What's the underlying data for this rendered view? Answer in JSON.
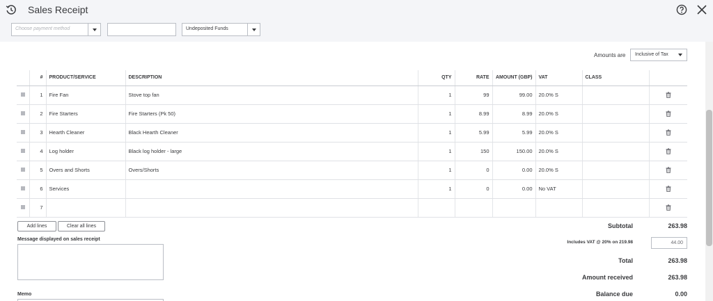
{
  "header": {
    "title": "Sales Receipt"
  },
  "payment": {
    "method_placeholder": "Choose payment method",
    "reference_value": "",
    "deposit_to": "Undeposited Funds"
  },
  "amounts": {
    "label": "Amounts are",
    "value": "Inclusive of Tax"
  },
  "table": {
    "headers": [
      "#",
      "PRODUCT/SERVICE",
      "DESCRIPTION",
      "QTY",
      "RATE",
      "AMOUNT (GBP)",
      "VAT",
      "CLASS"
    ],
    "rows": [
      {
        "num": "1",
        "product": "Fire Fan",
        "description": "Stove top fan",
        "qty": "1",
        "rate": "99",
        "amount": "99.00",
        "vat": "20.0% S",
        "class": ""
      },
      {
        "num": "2",
        "product": "Fire Starters",
        "description": "Fire Starters (Pk 50)",
        "qty": "1",
        "rate": "8.99",
        "amount": "8.99",
        "vat": "20.0% S",
        "class": ""
      },
      {
        "num": "3",
        "product": "Hearth Cleaner",
        "description": "Black Hearth Cleaner",
        "qty": "1",
        "rate": "5.99",
        "amount": "5.99",
        "vat": "20.0% S",
        "class": ""
      },
      {
        "num": "4",
        "product": "Log holder",
        "description": "Black log holder - large",
        "qty": "1",
        "rate": "150",
        "amount": "150.00",
        "vat": "20.0% S",
        "class": ""
      },
      {
        "num": "5",
        "product": "Overs and Shorts",
        "description": "Overs/Shorts",
        "qty": "1",
        "rate": "0",
        "amount": "0.00",
        "vat": "20.0% S",
        "class": ""
      },
      {
        "num": "6",
        "product": "Services",
        "description": "",
        "qty": "1",
        "rate": "0",
        "amount": "0.00",
        "vat": "No VAT",
        "class": ""
      },
      {
        "num": "7",
        "product": "",
        "description": "",
        "qty": "",
        "rate": "",
        "amount": "",
        "vat": "",
        "class": ""
      }
    ]
  },
  "buttons": {
    "add_lines": "Add lines",
    "clear_lines": "Clear all lines"
  },
  "message": {
    "label": "Message displayed on sales receipt",
    "value": ""
  },
  "memo": {
    "label": "Memo"
  },
  "totals": {
    "subtotal_label": "Subtotal",
    "subtotal": "263.98",
    "vat_label": "Includes VAT @ 20% on 219.98",
    "vat_value": "44.00",
    "total_label": "Total",
    "total": "263.98",
    "received_label": "Amount received",
    "received": "263.98",
    "balance_label": "Balance due",
    "balance": "0.00"
  }
}
